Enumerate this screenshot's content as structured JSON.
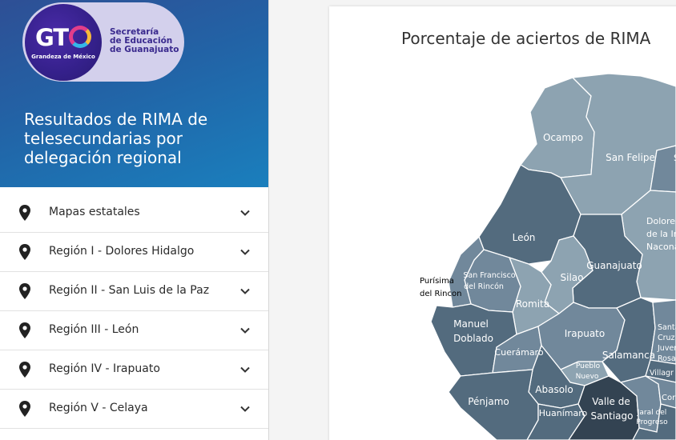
{
  "header": {
    "logo": {
      "wordmark": "GTO",
      "tagline": "Grandeza de México",
      "org_lines": [
        "Secretaría",
        "de Educación",
        "de Guanajuato"
      ]
    },
    "title_lines": [
      "Resultados de RIMA de",
      "telesecundarias por",
      "delegación regional"
    ]
  },
  "menu": {
    "items": [
      {
        "label": "Mapas estatales",
        "icon": "map-pin-icon"
      },
      {
        "label": "Región I - Dolores Hidalgo",
        "icon": "map-pin-icon"
      },
      {
        "label": "Región II - San Luis de la Paz",
        "icon": "map-pin-icon"
      },
      {
        "label": "Región III - León",
        "icon": "map-pin-icon"
      },
      {
        "label": "Región IV - Irapuato",
        "icon": "map-pin-icon"
      },
      {
        "label": "Región V - Celaya",
        "icon": "map-pin-icon"
      }
    ]
  },
  "map": {
    "title": "Porcentaje de aciertos de RIMA",
    "colors": {
      "light": "#8da3b1",
      "mid": "#71889b",
      "dark": "#536b7e",
      "darkest": "#334352",
      "border": "#ffffff"
    },
    "labels": {
      "ocampo": "Ocampo",
      "san_felipe": "San Felipe",
      "san_felipe_right": "S",
      "dolores": [
        "Dolores",
        "de la In",
        "Nacona"
      ],
      "leon": "León",
      "guanajuato": "Guanajuato",
      "purisima": [
        "Purísima",
        "del Rincon"
      ],
      "san_francisco": [
        "San Francisco",
        "del Rincón"
      ],
      "silao": "Silao",
      "romita": "Romita",
      "manuel_doblado": [
        "Manuel",
        "Doblado"
      ],
      "irapuato": "Irapuato",
      "cueramaro": "Cuerámaro",
      "salamanca": "Salamanca",
      "santa_cruz": [
        "Santa",
        "Cruz",
        "Juven",
        "Rosas"
      ],
      "villagran": "Villagr",
      "pueblo_nuevo": [
        "Pueblo",
        "Nuevo"
      ],
      "abasolo": "Abasolo",
      "penjamo": "Pénjamo",
      "valle": [
        "Valle de",
        "Santiago"
      ],
      "huanimaro": "Huanímaro",
      "jaral": [
        "Jaral del",
        "Progreso"
      ],
      "cortazar": "Cort"
    }
  }
}
